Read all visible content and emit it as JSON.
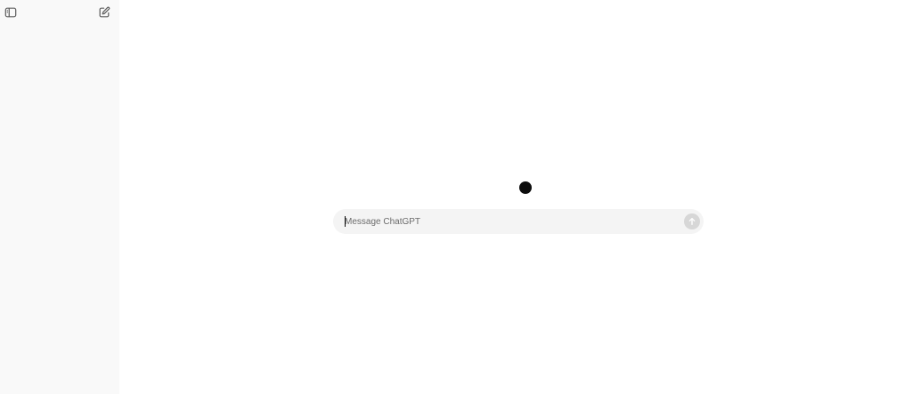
{
  "sidebar": {
    "toggle_icon": "sidebar-toggle-icon",
    "new_chat_icon": "compose-icon"
  },
  "composer": {
    "placeholder": "Message ChatGPT",
    "value": "",
    "send_icon": "arrow-up-icon"
  },
  "colors": {
    "sidebar_bg": "#f9f9f9",
    "composer_bg": "#f4f4f4",
    "send_button_disabled": "#d7d7d7",
    "loader": "#0d0d0d"
  }
}
